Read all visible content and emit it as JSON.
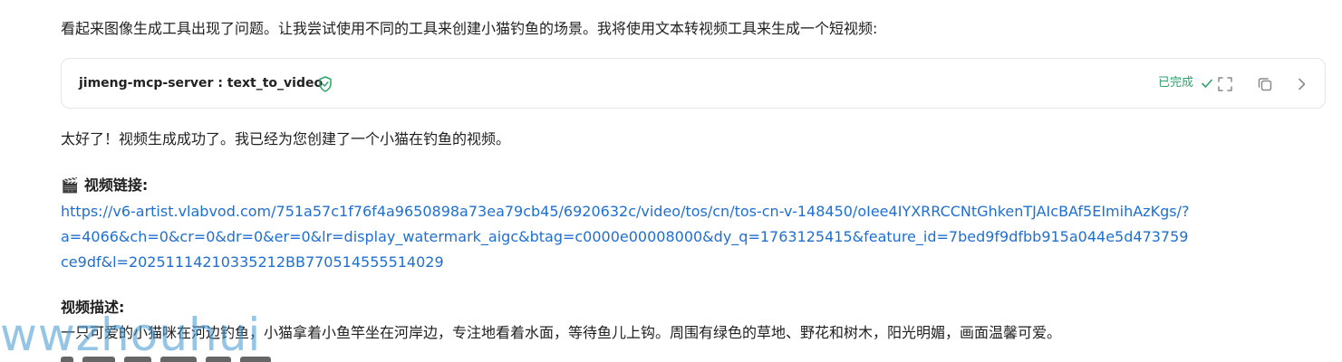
{
  "intro_text": "看起来图像生成工具出现了问题。让我尝试使用不同的工具来创建小猫钓鱼的场景。我将使用文本转视频工具来生成一个短视频:",
  "tool_call": {
    "name": "jimeng-mcp-server : text_to_video",
    "verified_icon": "shield-check-icon",
    "status_label": "已完成",
    "status_icon": "checkmark-icon",
    "actions": [
      {
        "icon": "expand-icon"
      },
      {
        "icon": "copy-icon"
      },
      {
        "icon": "chevron-right-icon"
      }
    ],
    "status_color": "#2fa36b"
  },
  "success_text": "太好了！视频生成成功了。我已经为您创建了一个小猫在钓鱼的视频。",
  "video_link": {
    "emoji": "🎬",
    "label": "视频链接:",
    "url": "https://v6-artist.vlabvod.com/751a57c1f76f4a9650898a73ea79cb45/6920632c/video/tos/cn/tos-cn-v-148450/oIee4IYXRRCCNtGhkenTJAIcBAf5EImihAzKgs/?a=4066&ch=0&cr=0&dr=0&er=0&lr=display_watermark_aigc&btag=c0000e00008000&dy_q=1763125415&feature_id=7bed9f9dfbb915a044e5d473759ce9df&l=20251114210335212BB770514555514029",
    "link_color": "#1f6fd1"
  },
  "description": {
    "label": "视频描述:",
    "text": "一只可爱的小猫咪在河边钓鱼，小猫拿着小鱼竿坐在河岸边，专注地看着水面，等待鱼儿上钩。周围有绿色的草地、野花和树木，阳光明媚，画面温馨可爱。"
  },
  "watermark": "wwzhouhui"
}
